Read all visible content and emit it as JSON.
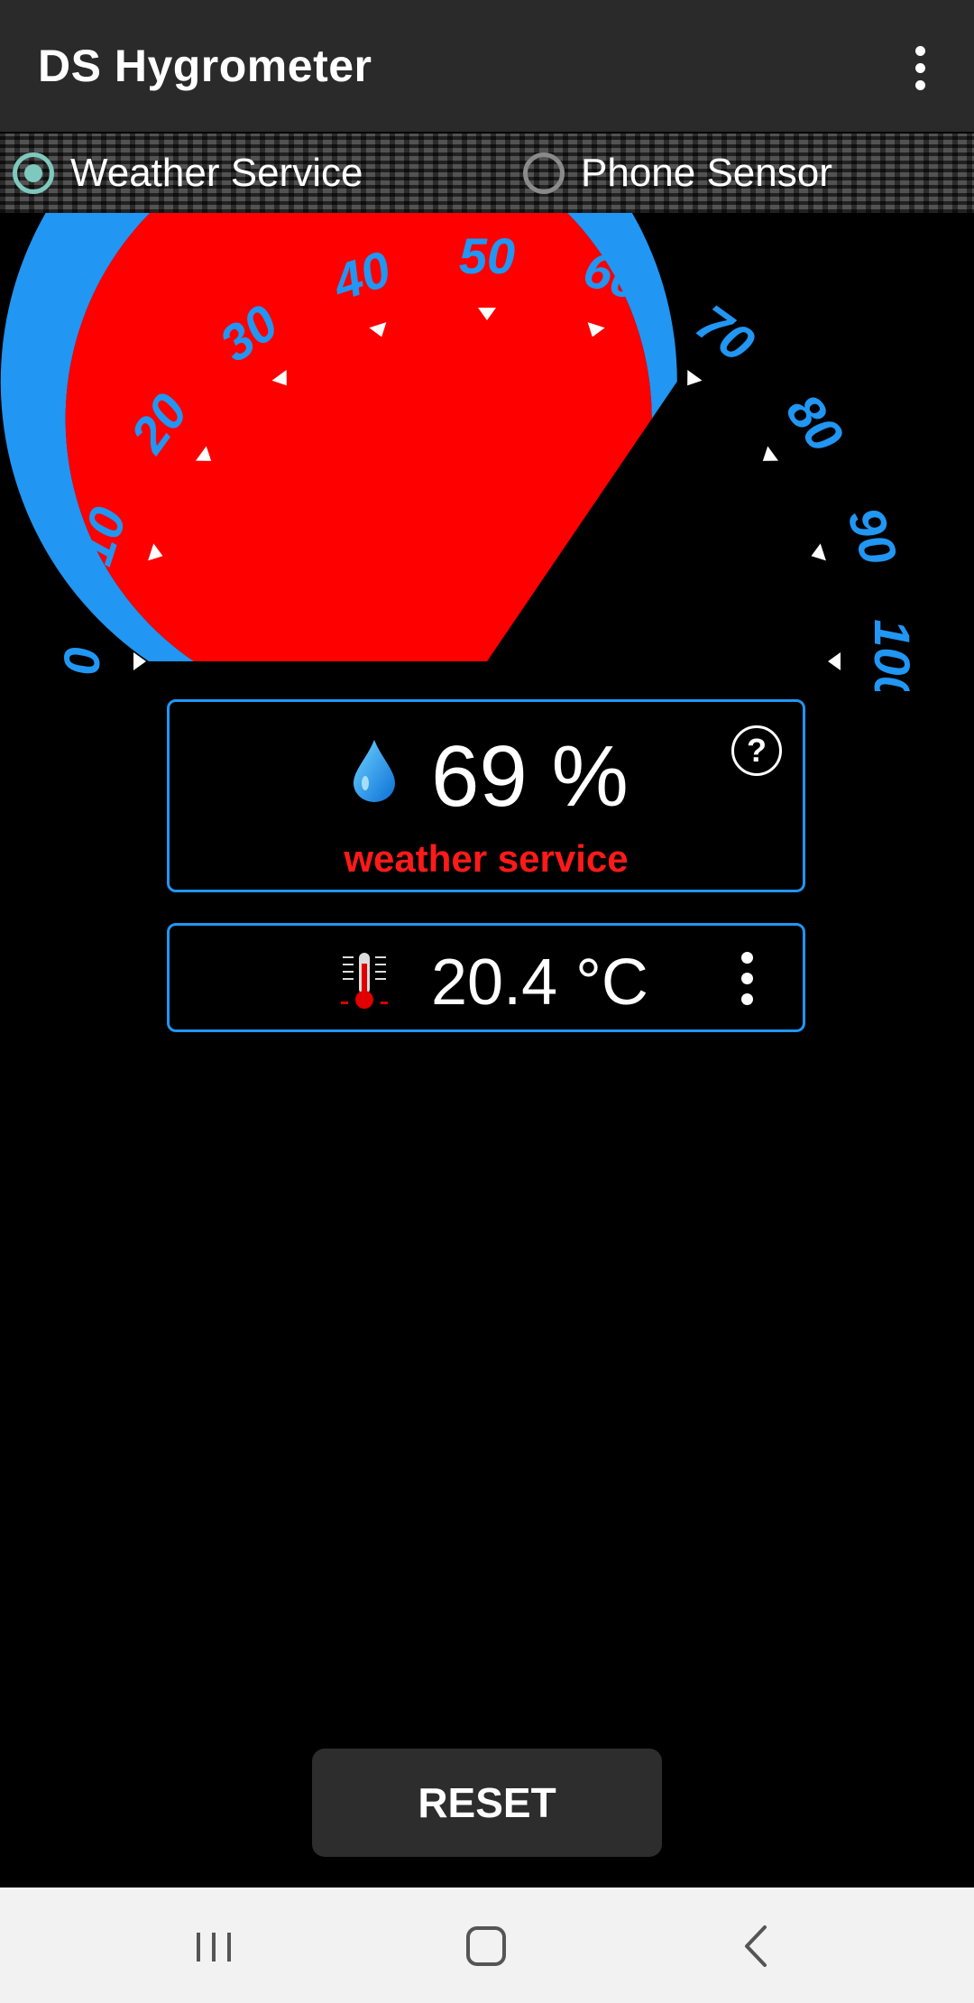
{
  "app": {
    "title": "DS Hygrometer"
  },
  "toolbar": {
    "overflow_icon": "more-vert-icon"
  },
  "source_selector": {
    "options": [
      {
        "label": "Weather Service",
        "checked": true
      },
      {
        "label": "Phone Sensor",
        "checked": false
      }
    ]
  },
  "gauge": {
    "min": 0,
    "max": 100,
    "value": 69,
    "tick_labels": [
      "0",
      "10",
      "20",
      "30",
      "40",
      "50",
      "60",
      "70",
      "80",
      "90",
      "100"
    ],
    "fill_color": "#ff0000",
    "arc_color": "#2196f3"
  },
  "humidity": {
    "value": "69 %",
    "source": "weather service",
    "icon": "water-drop-icon",
    "help_label": "?"
  },
  "temperature": {
    "value": "20.4 °C",
    "icon": "thermometer-icon"
  },
  "actions": {
    "reset_label": "RESET"
  },
  "navbar": {
    "items": [
      "recent-apps-icon",
      "home-icon",
      "back-icon"
    ]
  },
  "colors": {
    "accent": "#2196f3",
    "radio_checked": "#7fc8bd",
    "source_text": "#ff1a1a",
    "appbar": "#2a2a2a"
  }
}
